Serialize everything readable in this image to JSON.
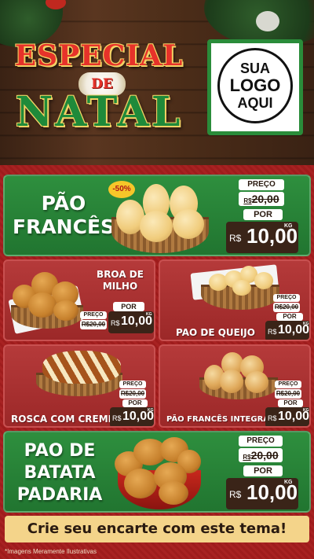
{
  "header": {
    "title_line1": "ESPECIAL",
    "title_line2": "DE",
    "title_line3": "NATAL",
    "logo_line1": "SUA",
    "logo_line2": "LOGO",
    "logo_line3": "AQUI"
  },
  "products": [
    {
      "name_lines": [
        "PÃO",
        "FRANCÊS"
      ],
      "discount_badge": "-50%",
      "old_label": "PREÇO",
      "old_price": "20,00",
      "old_currency": "R$",
      "new_label": "POR",
      "new_currency": "R$",
      "new_price": "10,00",
      "unit": "KG"
    },
    {
      "name_lines": [
        "BROA DE",
        "MILHO"
      ],
      "old_label": "PREÇO",
      "old_price": "R$20,00",
      "new_label": "POR",
      "new_currency": "R$",
      "new_price": "10,00",
      "unit": "KG"
    },
    {
      "name": "PAO DE QUEIJO",
      "old_label": "PREÇO",
      "old_price": "R$20,00",
      "new_label": "POR",
      "new_currency": "R$",
      "new_price": "10,00",
      "unit": "KG"
    },
    {
      "name": "ROSCA COM CREME",
      "old_label": "PREÇO",
      "old_price": "R$20,00",
      "new_label": "POR",
      "new_currency": "R$",
      "new_price": "10,00",
      "unit": "KG"
    },
    {
      "name": "PÃO FRANCÊS INTEGRAL",
      "old_label": "PREÇO",
      "old_price": "R$20,00",
      "new_label": "POR",
      "new_currency": "R$",
      "new_price": "10,00",
      "unit": "KG"
    },
    {
      "name_lines": [
        "PAO DE",
        "BATATA",
        "PADARIA"
      ],
      "old_label": "PREÇO",
      "old_price": "20,00",
      "old_currency": "R$",
      "new_label": "POR",
      "new_currency": "R$",
      "new_price": "10,00",
      "unit": "KG"
    }
  ],
  "footer": {
    "cta": "Crie seu encarte com este tema!",
    "disclaimer": "*Imagens Meramente Ilustrativas"
  },
  "colors": {
    "green": "#2e8f3e",
    "red": "#b53a3a",
    "price_dark": "#3a2418",
    "cta_bg": "#f4d48a"
  }
}
